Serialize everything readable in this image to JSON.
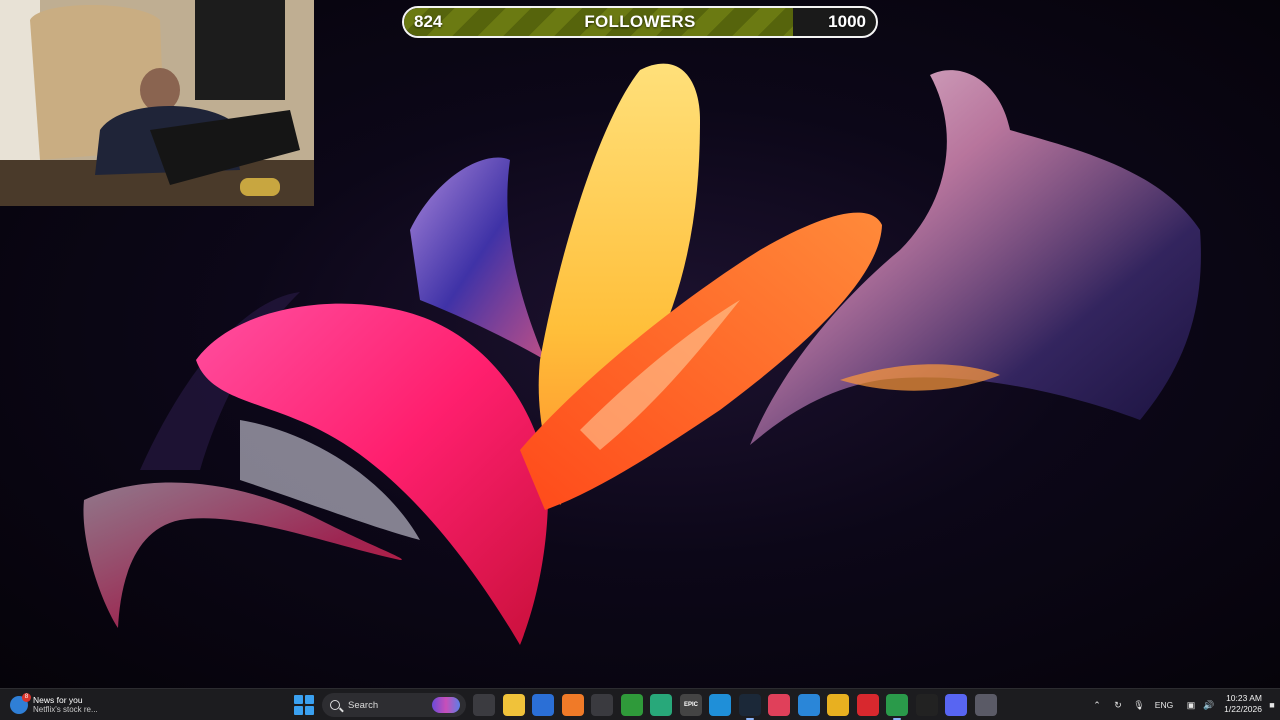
{
  "goal": {
    "current": "824",
    "label": "FOLLOWERS",
    "target": "1000",
    "progress_fraction": 0.824,
    "fill_color": "#6b7a12"
  },
  "taskbar": {
    "news": {
      "title": "News for you",
      "subtitle": "Netflix's stock re...",
      "badge": "8"
    },
    "search": {
      "placeholder": "Search"
    },
    "pinned_apps": [
      {
        "name": "task-view-icon"
      },
      {
        "name": "file-explorer-icon"
      },
      {
        "name": "store-icon"
      },
      {
        "name": "app-icon"
      },
      {
        "name": "settings-app-icon"
      },
      {
        "name": "minecraft-icon"
      },
      {
        "name": "chat-app-icon"
      },
      {
        "name": "epic-games-icon",
        "label": "EPIC"
      },
      {
        "name": "edge-icon"
      },
      {
        "name": "steam-icon"
      },
      {
        "name": "photos-icon"
      },
      {
        "name": "app-icon"
      },
      {
        "name": "app-icon"
      },
      {
        "name": "app-icon"
      },
      {
        "name": "chrome-icon"
      },
      {
        "name": "capcut-icon"
      },
      {
        "name": "discord-icon"
      },
      {
        "name": "gear-icon"
      }
    ],
    "tray": {
      "language": "ENG",
      "time": "10:23 AM",
      "date": "1/22/2026"
    }
  }
}
